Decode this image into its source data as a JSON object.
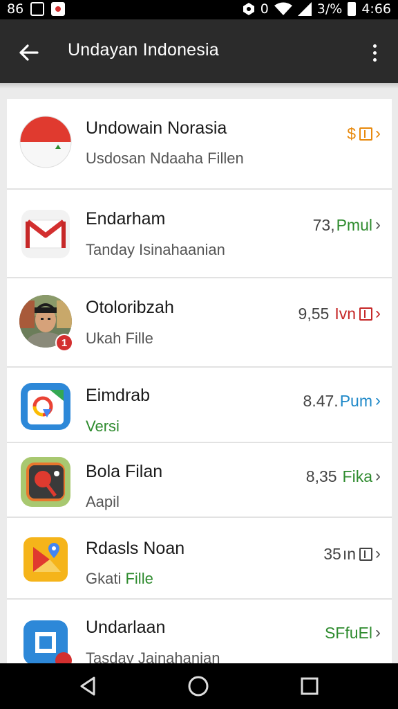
{
  "status_bar": {
    "left_text": "86",
    "battery_percent": "3/%",
    "time": "4:66",
    "signal_text": "0"
  },
  "app_bar": {
    "title": "Undayan Indonesia",
    "back_icon": "arrow-back-icon",
    "menu_icon": "more-vert-icon"
  },
  "items": [
    {
      "title": "Undowain Norasia",
      "subtitle": "Usdosan Ndaaha Fillen",
      "price_num": "",
      "price_unit": "$",
      "price_color": "#e8890c",
      "subtitle_color": "#555555",
      "icon": "indonesia-flag-icon"
    },
    {
      "title": "Endarham",
      "subtitle": "Tanday Isinahaanian",
      "price_num": "73,",
      "price_unit": "Pmul",
      "price_color": "#2e8b2e",
      "subtitle_color": "#555555",
      "icon": "gmail-icon"
    },
    {
      "title": "Otoloribzah",
      "subtitle": "Ukah Fille",
      "price_num": "9,55",
      "price_unit": "Ivn",
      "price_color": "#c62828",
      "subtitle_color": "#555555",
      "icon": "person-avatar-icon",
      "badge": "1"
    },
    {
      "title": "Eimdrab",
      "subtitle": "Versi",
      "price_num": "8.47.",
      "price_unit": "Pum",
      "price_color": "#1e88c8",
      "subtitle_color": "#2e8b2e",
      "icon": "google-calendar-icon"
    },
    {
      "title": "Bola Filan",
      "subtitle": "Aapil",
      "price_num": "8,35",
      "price_unit": "Fika",
      "price_color": "#2e8b2e",
      "subtitle_color": "#555555",
      "icon": "ping-pong-icon"
    },
    {
      "title": "Rdasls Noan",
      "subtitle_a": "Gkati",
      "subtitle_b": "Fille",
      "price_num": "35",
      "price_unit": "ın",
      "price_color": "#444444",
      "subtitle_color": "#2e8b2e",
      "icon": "maps-icon"
    },
    {
      "title": "Undarlaan",
      "subtitle": "Tasday Jainahanian",
      "price_num": "",
      "price_unit": "SFfuEl",
      "price_color": "#2e8b2e",
      "subtitle_color": "#555555",
      "icon": "blue-app-icon"
    }
  ],
  "nav_bar": {
    "back": "nav-back-icon",
    "home": "nav-home-icon",
    "recents": "nav-recents-icon"
  }
}
